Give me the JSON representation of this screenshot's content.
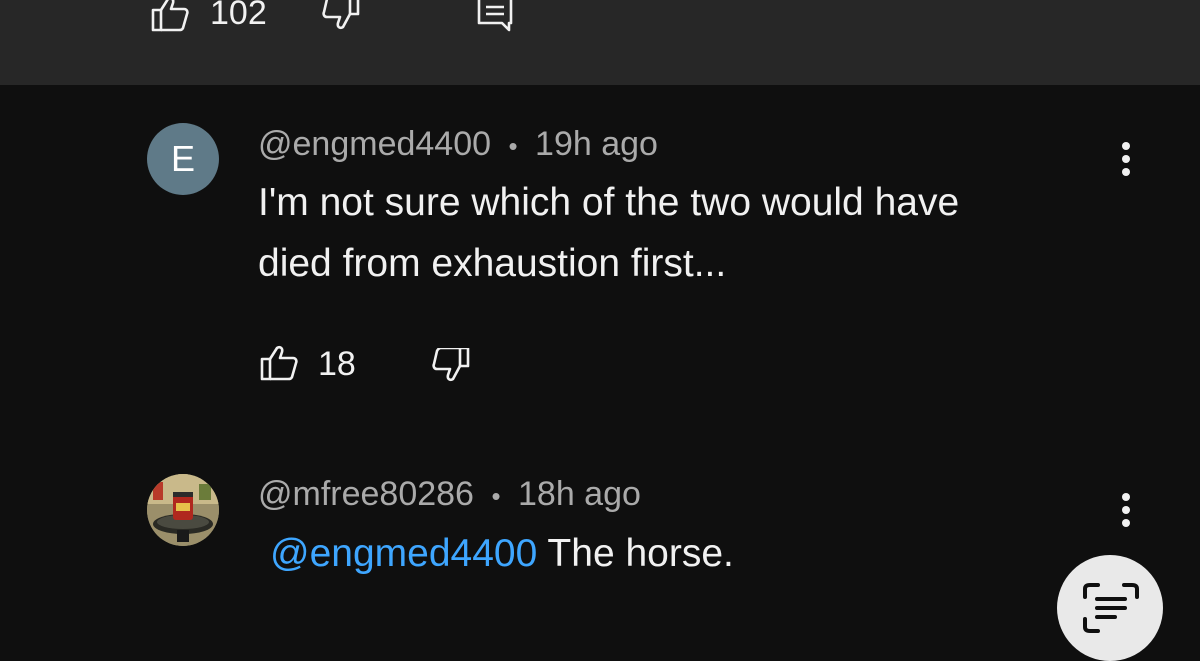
{
  "top_comment": {
    "like_count": "102",
    "icons": {
      "like": "thumbs-up-icon",
      "dislike": "thumbs-down-icon",
      "reply": "comment-icon"
    }
  },
  "comments": [
    {
      "avatar_letter": "E",
      "avatar_color": "#5f7a88",
      "handle": "@engmed4400",
      "separator": "•",
      "time": "19h ago",
      "text_line1": "I'm not sure which of the two would have",
      "text_line2": "died from exhaustion first...",
      "like_count": "18"
    },
    {
      "avatar_image": "photo-avatar",
      "handle": "@mfree80286",
      "separator": "•",
      "time": "18h ago",
      "mention": "@engmed4400",
      "text": " The horse."
    }
  ],
  "fab": {
    "icon": "transcript-scan-icon"
  },
  "colors": {
    "background": "#0f0f0f",
    "top_band": "#272727",
    "mention": "#3ea6ff",
    "meta": "#aaaaaa"
  }
}
